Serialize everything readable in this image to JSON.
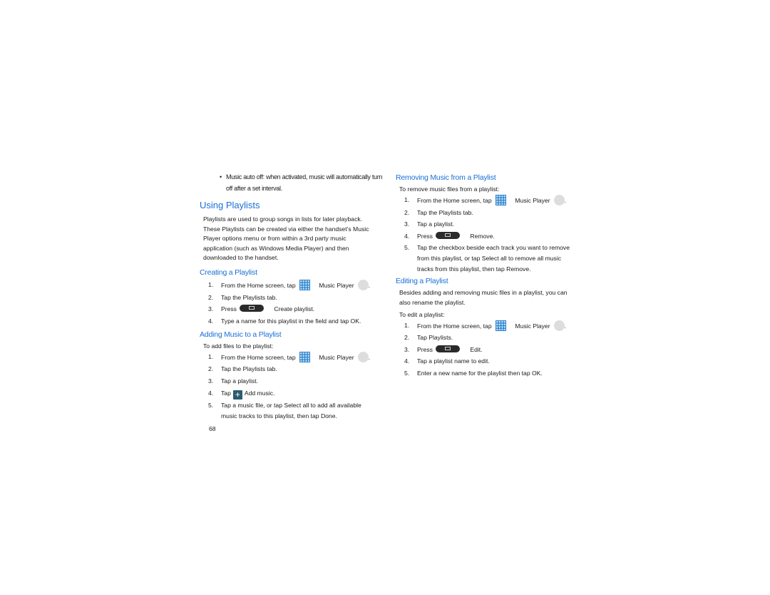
{
  "page": {
    "number": "68"
  },
  "left": {
    "bullet": {
      "marker": "•",
      "text_line1": "Music auto off: when activated, music will automatically turn",
      "text_line2": "off after a set interval."
    },
    "section_title": "Using Playlists",
    "section_intro": [
      "Playlists are used to group songs in lists for later playback.",
      "These Playlists can be created via either the handset’s Music",
      "Player options menu or from within a 3rd party music",
      "application (such as Windows Media Player) and then",
      "downloaded to the handset."
    ],
    "creating": {
      "title": "Creating a Playlist",
      "steps": [
        {
          "num": "1.",
          "pre": "From the Home screen, tap",
          "mid": "Music Player",
          "post": "."
        },
        {
          "num": "2.",
          "text": "Tap the Playlists tab."
        },
        {
          "num": "3.",
          "pre": "Press",
          "post": "Create playlist."
        },
        {
          "num": "4.",
          "text": "Type a name for this playlist in the field and tap OK."
        }
      ]
    },
    "adding": {
      "title": "Adding Music to a Playlist",
      "intro": "To add files to the playlist:",
      "steps": [
        {
          "num": "1.",
          "pre": "From the Home screen, tap",
          "mid": "Music Player",
          "post": "."
        },
        {
          "num": "2.",
          "text": "Tap the Playlists tab."
        },
        {
          "num": "3.",
          "text": "Tap a playlist."
        },
        {
          "num": "4.",
          "pre": "Tap",
          "post": "Add music."
        },
        {
          "num": "5.",
          "line1": "Tap a music file, or tap Select all to add all available",
          "line2": "music tracks to this playlist, then tap Done."
        }
      ]
    }
  },
  "right": {
    "removing": {
      "title": "Removing Music from a Playlist",
      "intro": "To remove music files from a playlist:",
      "steps": [
        {
          "num": "1.",
          "pre": "From the Home screen, tap",
          "mid": "Music Player",
          "post": "."
        },
        {
          "num": "2.",
          "text": "Tap the Playlists tab."
        },
        {
          "num": "3.",
          "text": "Tap a playlist."
        },
        {
          "num": "4.",
          "pre": "Press",
          "post": "Remove."
        },
        {
          "num": "5.",
          "line1": "Tap the checkbox beside each track you want to remove",
          "line2": "from this playlist, or tap Select all to remove all music",
          "line3": "tracks from this playlist, then tap Remove."
        }
      ]
    },
    "editing": {
      "title": "Editing a Playlist",
      "intro_line1": "Besides adding and removing music files in a playlist, you can",
      "intro_line2": "also rename the playlist.",
      "intro2": "To edit a playlist:",
      "steps": [
        {
          "num": "1.",
          "pre": "From the Home screen, tap",
          "mid": "Music Player",
          "post": "."
        },
        {
          "num": "2.",
          "text": "Tap Playlists."
        },
        {
          "num": "3.",
          "pre": "Press",
          "post": "Edit."
        },
        {
          "num": "4.",
          "text": "Tap a playlist name to edit."
        },
        {
          "num": "5.",
          "text": "Enter a new name for the playlist then tap OK."
        }
      ]
    }
  },
  "icons": {
    "apps": "apps-grid-icon",
    "music_player": "music-player-icon",
    "menu_key": "menu-key-icon",
    "add": "add-plus-icon",
    "add_glyph": "+"
  },
  "colors": {
    "heading": "#1a6fd6",
    "apps_icon": "#2a7fc9",
    "menu_key": "#2a2a2a",
    "add_icon": "#2c5a6e",
    "music_icon": "#dddddd"
  }
}
